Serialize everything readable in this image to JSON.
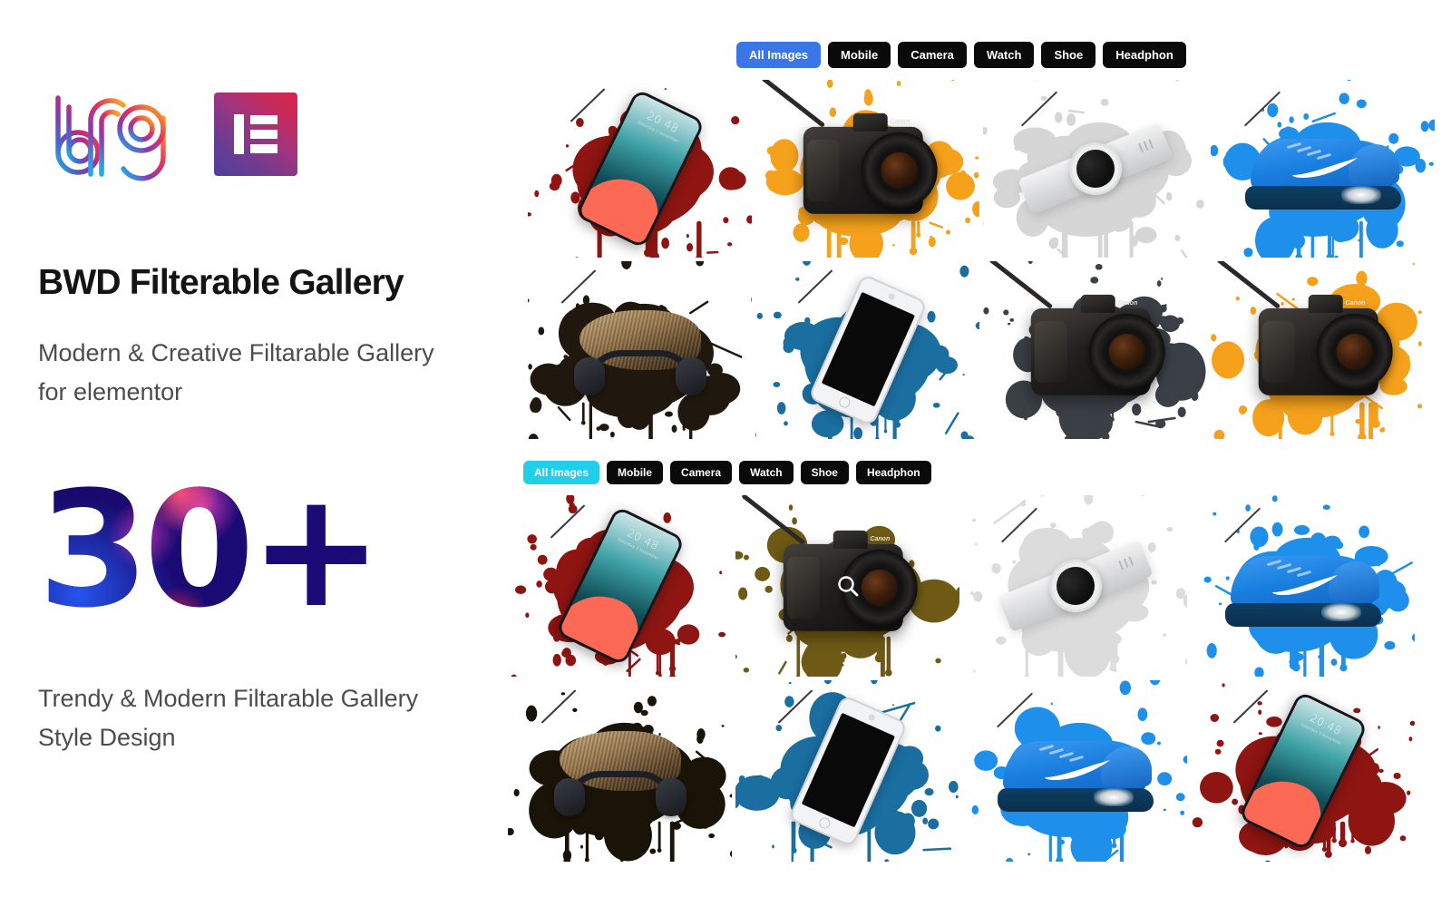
{
  "brand": {
    "bfg_logo_name": "bfg-logo",
    "elementor_logo_name": "elementor-logo",
    "accent_blue": "#3b76e8",
    "accent_cyan": "#22cfeb",
    "chip_dark": "#0a0a0a"
  },
  "left": {
    "headline": "BWD Filterable Gallery",
    "subline": "Modern & Creative Filtarable Gallery for elementor",
    "big_number": "30+",
    "tagline": "Trendy & Modern Filtarable Gallery Style Design"
  },
  "gallery_top": {
    "filters": [
      {
        "label": "All Images",
        "active": true
      },
      {
        "label": "Mobile",
        "active": false
      },
      {
        "label": "Camera",
        "active": false
      },
      {
        "label": "Watch",
        "active": false
      },
      {
        "label": "Shoe",
        "active": false
      },
      {
        "label": "Headphon",
        "active": false
      }
    ],
    "items": [
      {
        "category": "Mobile",
        "product": "smartphone",
        "splatter_color": "#8e1512",
        "screen_time": "20:48",
        "screen_date": "Saturday 2 November"
      },
      {
        "category": "Camera",
        "product": "dslr-camera",
        "splatter_color": "#f5a11b"
      },
      {
        "category": "Watch",
        "product": "smartwatch",
        "splatter_color": "#d6d6d6"
      },
      {
        "category": "Shoe",
        "product": "sneaker",
        "splatter_color": "#1e90ec"
      },
      {
        "category": "Headphon",
        "product": "headphones",
        "splatter_color": "#20180f"
      },
      {
        "category": "Mobile",
        "product": "phone-white",
        "splatter_color": "#1a6ea0"
      },
      {
        "category": "Camera",
        "product": "dslr-camera",
        "splatter_color": "#3b3f46"
      },
      {
        "category": "Camera",
        "product": "dslr-camera",
        "splatter_color": "#f5a11b"
      }
    ]
  },
  "gallery_bottom": {
    "filters": [
      {
        "label": "All Images",
        "active": true
      },
      {
        "label": "Mobile",
        "active": false
      },
      {
        "label": "Camera",
        "active": false
      },
      {
        "label": "Watch",
        "active": false
      },
      {
        "label": "Shoe",
        "active": false
      },
      {
        "label": "Headphon",
        "active": false
      }
    ],
    "items": [
      {
        "category": "Mobile",
        "product": "smartphone",
        "splatter_color": "#8e1512",
        "screen_time": "20:48",
        "screen_date": "Saturday 2 November"
      },
      {
        "category": "Camera",
        "product": "dslr-camera",
        "splatter_color": "#6e5a14",
        "hover_icon": "search-zoom-icon"
      },
      {
        "category": "Watch",
        "product": "smartwatch",
        "splatter_color": "#dcdcdc"
      },
      {
        "category": "Shoe",
        "product": "sneaker",
        "splatter_color": "#1e90ec"
      },
      {
        "category": "Headphon",
        "product": "headphones",
        "splatter_color": "#191308"
      },
      {
        "category": "Mobile",
        "product": "phone-white",
        "splatter_color": "#1a6ea0"
      },
      {
        "category": "Shoe",
        "product": "sneaker",
        "splatter_color": "#1e90ec"
      },
      {
        "category": "Mobile",
        "product": "smartphone",
        "splatter_color": "#8e1512",
        "screen_time": "20:48",
        "screen_date": "Saturday 2 November"
      }
    ]
  }
}
